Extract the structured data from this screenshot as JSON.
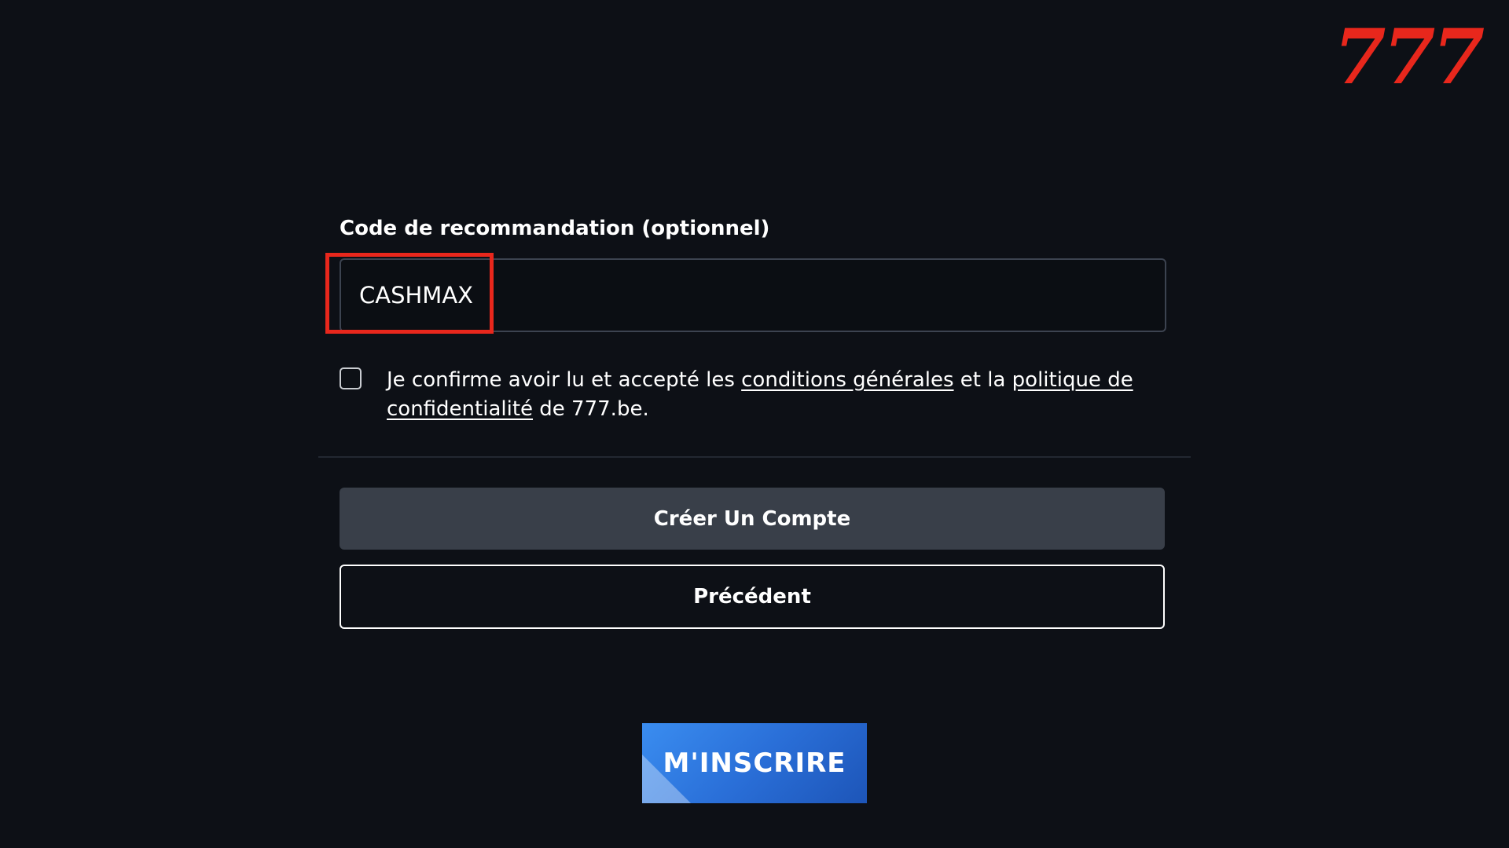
{
  "brand": {
    "logo_text": "777",
    "logo_color": "#e8271c"
  },
  "referral": {
    "label": "Code de recommandation (optionnel)",
    "value": "CASHMAX",
    "highlight_color": "#e8271c"
  },
  "consent": {
    "checked": false,
    "text_before": "Je confirme avoir lu et accepté les ",
    "terms_link": "conditions générales",
    "text_middle": " et la ",
    "privacy_link": "politique de confidentialité",
    "text_after": " de 777.be."
  },
  "actions": {
    "create_account": "Créer Un Compte",
    "previous": "Précédent"
  },
  "cta": {
    "label": "M'INSCRIRE",
    "color": "#2a6fd8"
  }
}
